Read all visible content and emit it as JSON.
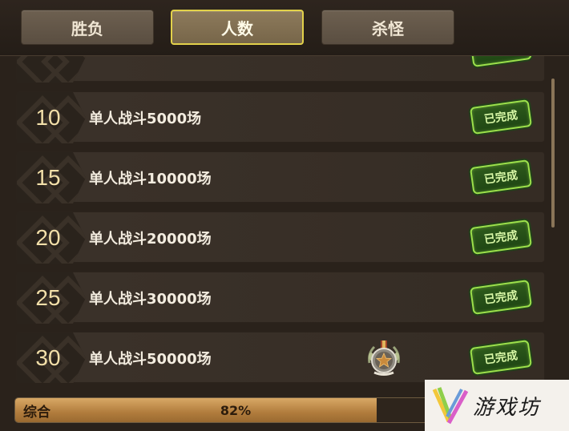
{
  "tabs": [
    {
      "label": "胜负",
      "active": false
    },
    {
      "label": "人数",
      "active": true
    },
    {
      "label": "杀怪",
      "active": false
    }
  ],
  "rows": [
    {
      "num": "10",
      "title": "单人战斗5000场",
      "status": "已完成",
      "medal": false
    },
    {
      "num": "15",
      "title": "单人战斗10000场",
      "status": "已完成",
      "medal": false
    },
    {
      "num": "20",
      "title": "单人战斗20000场",
      "status": "已完成",
      "medal": false
    },
    {
      "num": "25",
      "title": "单人战斗30000场",
      "status": "已完成",
      "medal": false
    },
    {
      "num": "30",
      "title": "单人战斗50000场",
      "status": "已完成",
      "medal": true,
      "medal_icon": "star-medal-icon"
    }
  ],
  "progress": {
    "label": "综合",
    "percent_text": "82%",
    "value": 0.82
  },
  "watermark": {
    "text": "游戏坊"
  },
  "colors": {
    "accent": "#e2d14a",
    "stamp_green": "#9be14b",
    "progress": "#c8944f"
  }
}
